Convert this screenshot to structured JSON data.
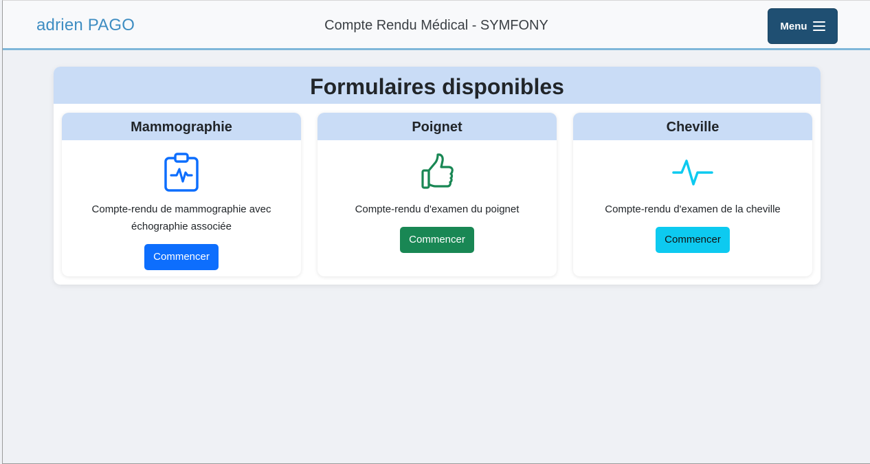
{
  "navbar": {
    "brand": "adrien PAGO",
    "title": "Compte Rendu Médical - SYMFONY",
    "menu_label": "Menu",
    "menu_icon": "hamburger-icon"
  },
  "panel": {
    "title": "Formulaires disponibles"
  },
  "cards": [
    {
      "title": "Mammographie",
      "icon": "clipboard-pulse-icon",
      "description": "Compte-rendu de mammographie avec échographie associée",
      "button": "Commencer",
      "color": "#0d6efd"
    },
    {
      "title": "Poignet",
      "icon": "hand-thumbs-up-icon",
      "description": "Compte-rendu d'examen du poignet",
      "button": "Commencer",
      "color": "#198754"
    },
    {
      "title": "Cheville",
      "icon": "activity-icon",
      "description": "Compte-rendu d'examen de la cheville",
      "button": "Commencer",
      "color": "#0dcaf0"
    }
  ],
  "colors": {
    "header_bg": "#c9dcf6",
    "navbar_accent": "#7fb7d9",
    "menu_button": "#1f4f72",
    "brand": "#3e8dc2"
  }
}
